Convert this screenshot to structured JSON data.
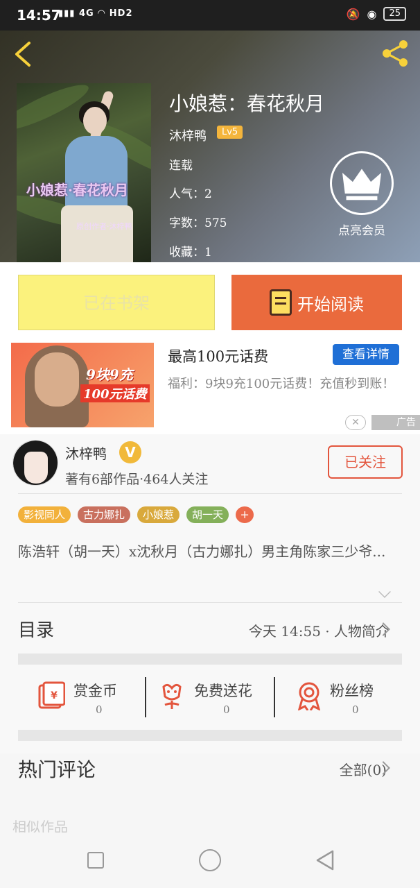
{
  "status_bar": {
    "time": "14:57",
    "signal_text": "4G",
    "hd_label": "HD2",
    "battery": "25"
  },
  "book": {
    "title": "小娘惹：春花秋月",
    "author": "沐梓鸭",
    "level": "Lv5",
    "status": "连载",
    "popularity": "人气：2",
    "word_count": "字数：575",
    "favorites": "收藏：1",
    "cover_title": "小娘惹·春花秋月",
    "cover_author": "原创作者·沐梓鸭"
  },
  "vip": {
    "label": "点亮会员"
  },
  "actions": {
    "shelf_label": "已在书架",
    "read_label": "开始阅读"
  },
  "ad": {
    "img_text1": "9块9充",
    "img_text2": "100元话费",
    "title": "最高100元话费",
    "button": "查看详情",
    "description": "福利：9块9充100元话费！充值秒到账！",
    "close": "✕",
    "tag": "广告"
  },
  "author": {
    "name": "沐梓鸭",
    "verified": "V",
    "stats": "著有6部作品·464人关注",
    "follow_label": "已关注"
  },
  "tags": [
    {
      "label": "影视同人",
      "color": "#f2b13b"
    },
    {
      "label": "古力娜扎",
      "color": "#c9705e"
    },
    {
      "label": "小娘惹",
      "color": "#d9a93c"
    },
    {
      "label": "胡一天",
      "color": "#84b05a"
    }
  ],
  "tag_more": "+",
  "intro": "陈浩轩（胡一天）x沈秋月（古力娜扎）男主角陈家三少爷...",
  "toc": {
    "label": "目录",
    "latest": "今天 14:55 · 人物简介"
  },
  "stats": [
    {
      "label": "赏金币",
      "value": "0"
    },
    {
      "label": "免费送花",
      "value": "0"
    },
    {
      "label": "粉丝榜",
      "value": "0"
    }
  ],
  "comments": {
    "label": "热门评论",
    "all": "全部(0)"
  },
  "similar": {
    "label": "相似作品"
  },
  "colors": {
    "accent_orange": "#ea6a3d",
    "shelf_yellow": "#fbf27d",
    "icon_yellow": "#f7d13b",
    "icon_red": "#e3553d"
  }
}
